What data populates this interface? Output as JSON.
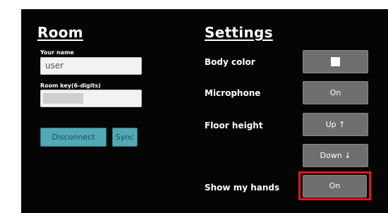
{
  "room": {
    "title": "Room",
    "name_label": "Your name",
    "name_value": "user",
    "room_key_label": "Room key(6-digits)",
    "room_key_value": "",
    "disconnect_label": "Disconnect",
    "sync_label": "Sync"
  },
  "settings": {
    "title": "Settings",
    "body_color_label": "Body color",
    "body_color_value": "#ffffff",
    "microphone_label": "Microphone",
    "microphone_value": "On",
    "floor_height_label": "Floor height",
    "floor_up_label": "Up ↑",
    "floor_down_label": "Down ↓",
    "show_hands_label": "Show my hands",
    "show_hands_value": "On"
  },
  "colors": {
    "background": "#050505",
    "teal_button": "#52a9b6",
    "gray_button": "#6f6f6f",
    "highlight": "#e8141c"
  }
}
